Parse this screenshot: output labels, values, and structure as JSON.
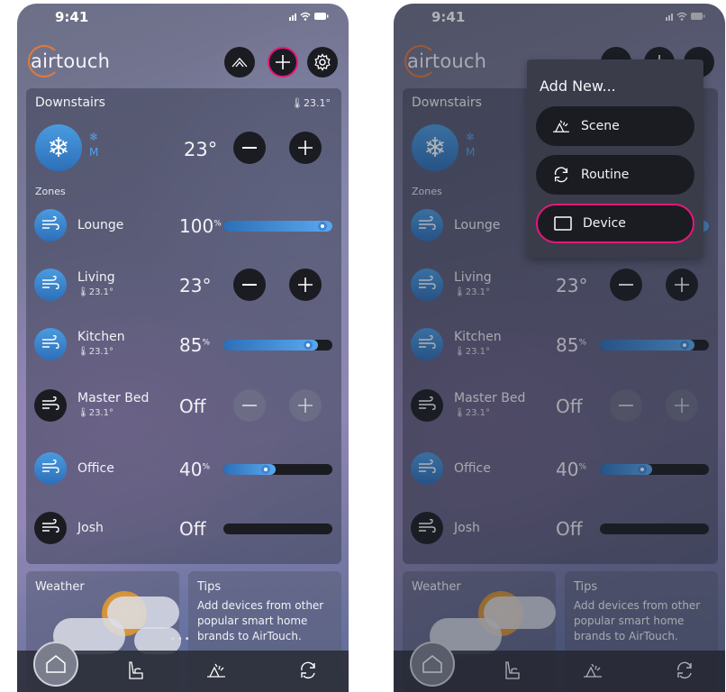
{
  "status": {
    "time": "9:41",
    "icons": "..ıl ≋ ▬"
  },
  "brand": "airtouch",
  "zone_group": {
    "name": "Downstairs",
    "temp": "23.1°",
    "setpoint": "23°",
    "mode_symbol": "❄",
    "mode_letter": "M"
  },
  "zones_label": "Zones",
  "zones": [
    {
      "name": "Lounge",
      "sub": "",
      "value": "100",
      "unit": "%",
      "level": 1.0,
      "kind": "slider",
      "active": true
    },
    {
      "name": "Living",
      "sub": "23.1°",
      "value": "23°",
      "unit": "",
      "kind": "stepper",
      "active": true
    },
    {
      "name": "Kitchen",
      "sub": "23.1°",
      "value": "85",
      "unit": "%",
      "level": 0.85,
      "kind": "slider",
      "active": true
    },
    {
      "name": "Master Bed",
      "sub": "23.1°",
      "value": "Off",
      "unit": "",
      "kind": "stepper-off",
      "active": false
    },
    {
      "name": "Office",
      "sub": "",
      "value": "40",
      "unit": "%",
      "level": 0.4,
      "kind": "slider",
      "active": true
    },
    {
      "name": "Josh",
      "sub": "",
      "value": "Off",
      "unit": "",
      "level": 0.0,
      "kind": "slider-off",
      "active": false
    }
  ],
  "weather": {
    "title": "Weather"
  },
  "tips": {
    "title": "Tips",
    "text": "Add devices from other popular smart home brands to AirTouch."
  },
  "popup": {
    "title": "Add New...",
    "items": [
      {
        "label": "Scene",
        "icon": "scene-icon"
      },
      {
        "label": "Routine",
        "icon": "routine-icon"
      },
      {
        "label": "Device",
        "icon": "device-icon",
        "highlighted": true
      }
    ]
  },
  "colors": {
    "accent": "#e6177a",
    "blue": "#3d86d6",
    "dark": "#1b1c22",
    "logo": "#e37a3a"
  }
}
